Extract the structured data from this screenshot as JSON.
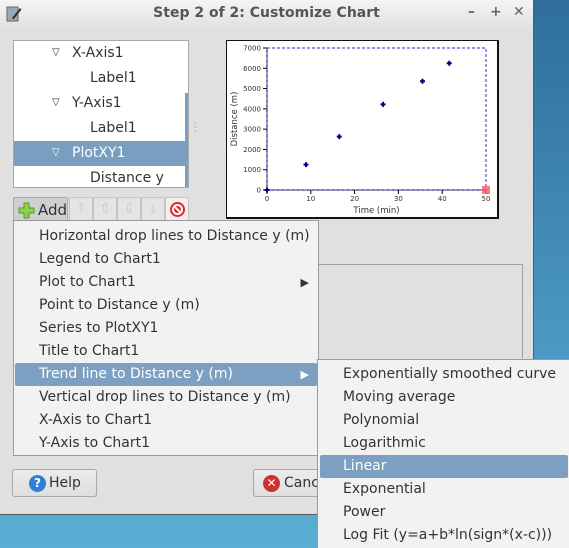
{
  "window": {
    "title": "Step 2 of 2: Customize Chart",
    "controls": {
      "minimize": "–",
      "maximize": "+",
      "close": "✕"
    }
  },
  "tree": {
    "items": [
      {
        "label": "X-Axis1",
        "expanded": true,
        "level": 1
      },
      {
        "label": "Label1",
        "level": 2
      },
      {
        "label": "Y-Axis1",
        "expanded": true,
        "level": 1
      },
      {
        "label": "Label1",
        "level": 2
      },
      {
        "label": "PlotXY1",
        "expanded": true,
        "level": 1,
        "selected": true
      },
      {
        "label": "Distance y (m)",
        "level": 2
      }
    ]
  },
  "toolbar": {
    "add_label": "Add",
    "icons": [
      "plus-icon",
      "move-top-icon",
      "move-up-icon",
      "move-down-icon",
      "move-bottom-icon",
      "delete-icon"
    ]
  },
  "add_menu": {
    "items": [
      {
        "label": "Horizontal drop lines to Distance y (m)"
      },
      {
        "label": "Legend to Chart1"
      },
      {
        "label": "Plot to Chart1",
        "submenu": true
      },
      {
        "label": "Point to Distance y (m)"
      },
      {
        "label": "Series to PlotXY1"
      },
      {
        "label": "Title to Chart1"
      },
      {
        "label": "Trend line to Distance y (m)",
        "submenu": true,
        "highlighted": true
      },
      {
        "label": "Vertical drop lines to Distance y (m)"
      },
      {
        "label": "X-Axis to Chart1"
      },
      {
        "label": "Y-Axis to Chart1"
      }
    ]
  },
  "trend_submenu": {
    "items": [
      {
        "label": "Exponentially smoothed curve"
      },
      {
        "label": "Moving average"
      },
      {
        "label": "Polynomial"
      },
      {
        "label": "Logarithmic"
      },
      {
        "label": "Linear",
        "highlighted": true
      },
      {
        "label": "Exponential"
      },
      {
        "label": "Power"
      },
      {
        "label": "Log Fit (y=a+b*ln(sign*(x-c)))"
      }
    ]
  },
  "buttons": {
    "help": "Help",
    "cancel": "Cance"
  },
  "colors": {
    "selection": "#7c9fc2",
    "marker": "#00007f",
    "frame_dash": "#2a2ad6",
    "handle": "#ff5a5a"
  },
  "chart_data": {
    "type": "scatter",
    "title": "",
    "xlabel": "Time (min)",
    "ylabel": "Distance (m)",
    "xlim": [
      0,
      50
    ],
    "ylim": [
      0,
      7000
    ],
    "xticks": [
      0,
      10,
      20,
      30,
      40,
      50
    ],
    "yticks": [
      0,
      1000,
      2000,
      3000,
      4000,
      5000,
      6000,
      7000
    ],
    "grid": false,
    "series": [
      {
        "name": "Distance y (m)",
        "x": [
          0,
          8.9,
          16.5,
          26.5,
          35.5,
          41.6
        ],
        "y": [
          0,
          1250,
          2630,
          4220,
          5360,
          6250
        ]
      }
    ]
  }
}
